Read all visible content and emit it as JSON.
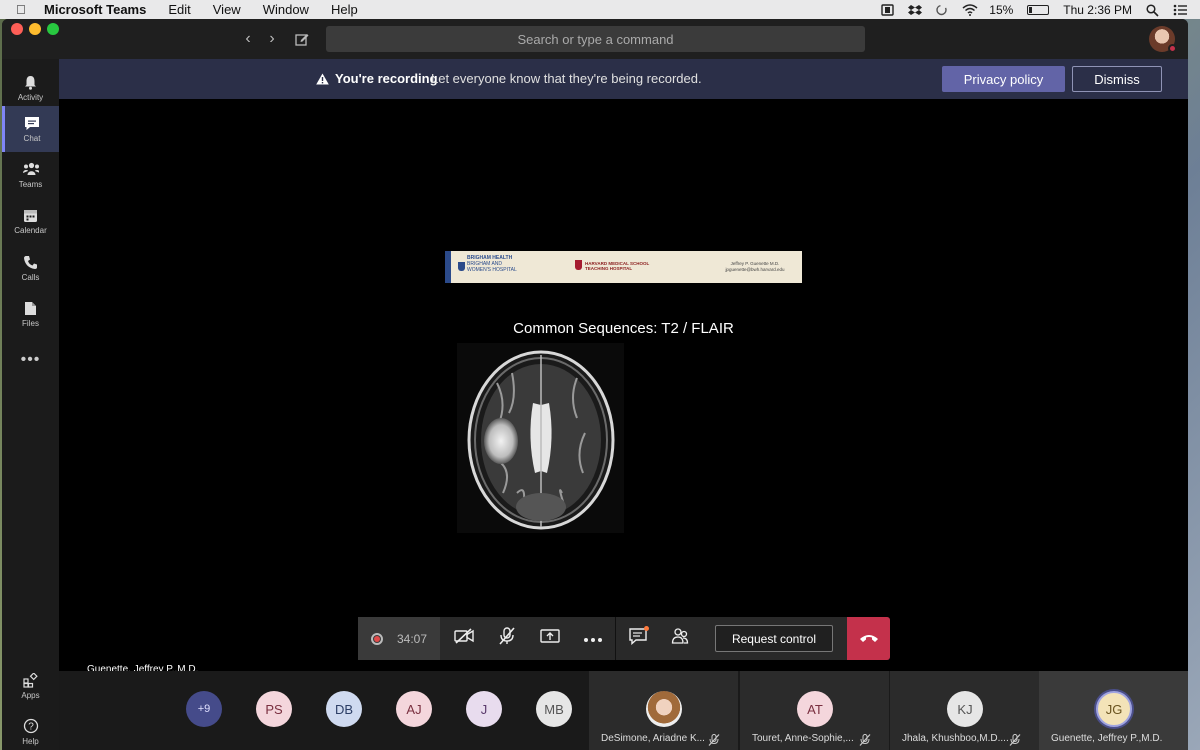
{
  "menubar": {
    "app_name": "Microsoft Teams",
    "menus": [
      "Edit",
      "View",
      "Window",
      "Help"
    ],
    "battery": "15%",
    "clock": "Thu 2:36 PM"
  },
  "titlebar": {
    "search_placeholder": "Search or type a command"
  },
  "rail": {
    "items": [
      {
        "label": "Activity",
        "icon": "bell-icon"
      },
      {
        "label": "Chat",
        "icon": "chat-icon"
      },
      {
        "label": "Teams",
        "icon": "teams-icon"
      },
      {
        "label": "Calendar",
        "icon": "calendar-icon"
      },
      {
        "label": "Calls",
        "icon": "phone-icon"
      },
      {
        "label": "Files",
        "icon": "file-icon"
      }
    ],
    "bottom": [
      {
        "label": "Apps",
        "icon": "apps-icon"
      },
      {
        "label": "Help",
        "icon": "help-icon"
      }
    ]
  },
  "banner": {
    "title": "You're recording",
    "message": "Let everyone know that they're being recorded.",
    "privacy_label": "Privacy policy",
    "dismiss_label": "Dismiss"
  },
  "slide": {
    "org1_line1": "BRIGHAM HEALTH",
    "org1_line2": "BRIGHAM AND",
    "org1_line3": "WOMEN'S HOSPITAL",
    "org2_line1": "HARVARD MEDICAL SCHOOL",
    "org2_line2": "TEACHING HOSPITAL",
    "author_name": "Jeffrey P. Guenette M.D.",
    "author_email": "jpguenette@bwh.harvard.edu",
    "title": "Common Sequences: T2 / FLAIR"
  },
  "presenter_name": "Guenette, Jeffrey P.,M.D.",
  "controls": {
    "timer": "34:07",
    "request_control_label": "Request control"
  },
  "participants": {
    "overflow": "+9",
    "avatars": [
      "PS",
      "DB",
      "AJ",
      "J",
      "MB"
    ],
    "tiles": [
      {
        "name": "DeSimone, Ariadne K...",
        "initials": ""
      },
      {
        "name": "Touret, Anne-Sophie,...",
        "initials": "AT"
      },
      {
        "name": "Jhala, Khushboo,M.D....",
        "initials": "KJ"
      },
      {
        "name": "Guenette, Jeffrey P.,M.D.",
        "initials": "JG"
      }
    ]
  },
  "colors": {
    "accent": "#6264a7",
    "hangup": "#c4314b",
    "banner": "#2b2f48"
  }
}
